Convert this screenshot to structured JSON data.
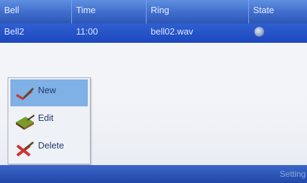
{
  "table": {
    "columns": [
      "Bell",
      "Time",
      "Ring",
      "State"
    ],
    "rows": [
      {
        "bell": "Bell2",
        "time": "11:00",
        "ring": "bell02.wav",
        "state_icon": "sync-icon"
      }
    ]
  },
  "context_menu": {
    "items": [
      {
        "label": "New",
        "icon": "new-icon"
      },
      {
        "label": "Edit",
        "icon": "edit-icon"
      },
      {
        "label": "Delete",
        "icon": "delete-icon"
      }
    ]
  },
  "footer": {
    "text": "Setting"
  },
  "colors": {
    "header": "#3f6ccc",
    "selected_row": "#1d48c0",
    "menu_highlight": "#7fb0e6"
  }
}
